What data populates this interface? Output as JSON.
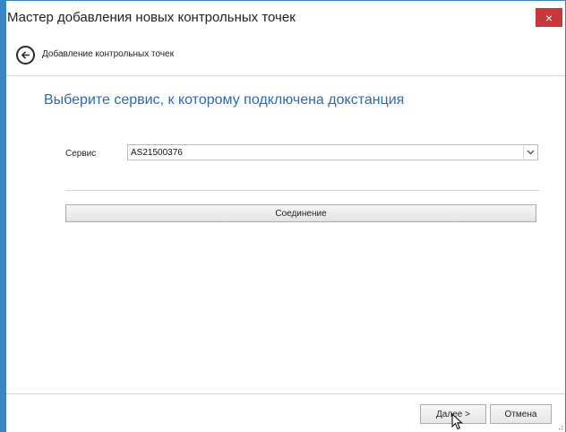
{
  "window": {
    "title": "Мастер добавления новых контрольных точек",
    "close_label": "×"
  },
  "subheader": {
    "title": "Добавление контрольных точек"
  },
  "main": {
    "heading": "Выберите сервис, к которому подключена докстанция",
    "service": {
      "label": "Сервис",
      "value": "AS21500376"
    },
    "connect_button_label": "Соединение"
  },
  "footer": {
    "next_label": "Далее >",
    "cancel_label": "Отмена"
  },
  "colors": {
    "accent": "#3a84c8",
    "heading": "#2a6ab5",
    "close": "#c7383c"
  },
  "icons": {
    "back": "arrow-left-circle-icon",
    "dropdown": "chevron-down-icon",
    "cursor": "mouse-pointer-icon",
    "grip": "resize-grip-icon"
  }
}
